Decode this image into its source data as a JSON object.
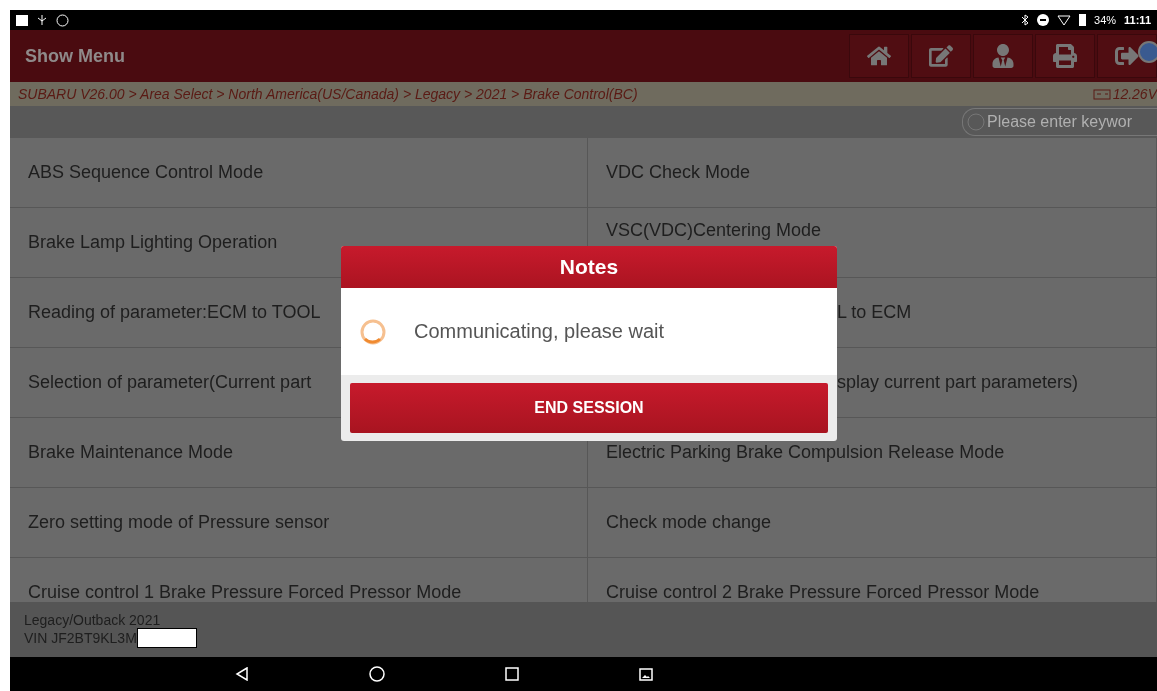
{
  "status_bar": {
    "battery": "34%",
    "time": "11:11"
  },
  "header": {
    "title": "Show Menu"
  },
  "breadcrumb": {
    "path": "SUBARU V26.00 > Area Select > North America(US/Canada) > Legacy > 2021 > Brake Control(BC)",
    "voltage": "12.26V"
  },
  "search": {
    "placeholder": "Please enter keywor"
  },
  "functions": [
    {
      "text": "ABS Sequence Control Mode",
      "kind": "full"
    },
    {
      "text": "VDC Check Mode",
      "kind": "full"
    },
    {
      "text": "Brake Lamp Lighting Operation",
      "kind": "full"
    },
    {
      "text": "VSC(VDC)Centering Mode",
      "kind": "above"
    },
    {
      "text": "Reading of parameter:ECM to TOOL",
      "kind": "full"
    },
    {
      "text": "L to ECM",
      "kind": "behind"
    },
    {
      "text": "Selection of parameter(Current part",
      "kind": "full"
    },
    {
      "text": "splay current part parameters)",
      "kind": "behind"
    },
    {
      "text": "Brake Maintenance Mode",
      "kind": "full"
    },
    {
      "text": "Electric Parking Brake Compulsion Release Mode",
      "kind": "full"
    },
    {
      "text": "Zero setting mode of Pressure sensor",
      "kind": "full"
    },
    {
      "text": "Check mode change",
      "kind": "full"
    },
    {
      "text": "Cruise control 1 Brake Pressure Forced Pressor Mode",
      "kind": "full"
    },
    {
      "text": "Cruise control 2 Brake Pressure Forced Pressor Mode",
      "kind": "full"
    }
  ],
  "footer": {
    "model": "Legacy/Outback 2021",
    "vin": "VIN JF2BT9KL3M"
  },
  "dialog": {
    "title": "Notes",
    "message": "Communicating, please wait",
    "button": "END SESSION"
  }
}
